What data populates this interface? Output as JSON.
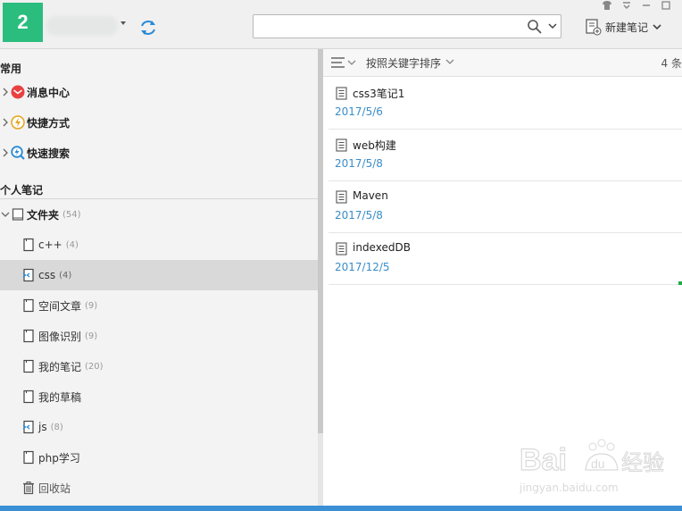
{
  "header": {
    "avatar_text": "2",
    "search": {
      "value": "",
      "placeholder": ""
    },
    "new_note_label": "新建笔记"
  },
  "sidebar": {
    "common_title": "常用",
    "common_items": [
      {
        "label": "消息中心",
        "icon": "message-icon"
      },
      {
        "label": "快捷方式",
        "icon": "lightning-icon"
      },
      {
        "label": "快速搜索",
        "icon": "quick-search-icon"
      }
    ],
    "personal_title": "个人笔记",
    "folder": {
      "label": "文件夹",
      "count": "(54)"
    },
    "subfolders": [
      {
        "label": "c++",
        "count": "(4)",
        "icon": "notebook-icon",
        "selected": false
      },
      {
        "label": "css",
        "count": "(4)",
        "icon": "code-notebook-icon",
        "selected": true
      },
      {
        "label": "空间文章",
        "count": "(9)",
        "icon": "notebook-icon",
        "selected": false
      },
      {
        "label": "图像识别",
        "count": "(9)",
        "icon": "notebook-icon",
        "selected": false
      },
      {
        "label": "我的笔记",
        "count": "(20)",
        "icon": "notebook-icon",
        "selected": false
      },
      {
        "label": "我的草稿",
        "count": "",
        "icon": "notebook-icon",
        "selected": false
      },
      {
        "label": "js",
        "count": "(8)",
        "icon": "code-notebook-icon",
        "selected": false
      },
      {
        "label": "php学习",
        "count": "",
        "icon": "notebook-icon",
        "selected": false
      },
      {
        "label": "回收站",
        "count": "",
        "icon": "trash-icon",
        "selected": false
      }
    ]
  },
  "notes_panel": {
    "sort_label": "按照关键字排序",
    "count_text": "4 条",
    "notes": [
      {
        "title": "css3笔记1",
        "date": "2017/5/6"
      },
      {
        "title": "web构建",
        "date": "2017/5/8"
      },
      {
        "title": "Maven",
        "date": "2017/5/8"
      },
      {
        "title": "indexedDB",
        "date": "2017/12/5"
      }
    ]
  },
  "watermark": {
    "text": "Bai du 经验",
    "url_text": "jingyan.baidu.com"
  },
  "colors": {
    "accent": "#2bbd7e",
    "date_blue": "#3a8dc8",
    "selected_bg": "#d9d9d9"
  }
}
